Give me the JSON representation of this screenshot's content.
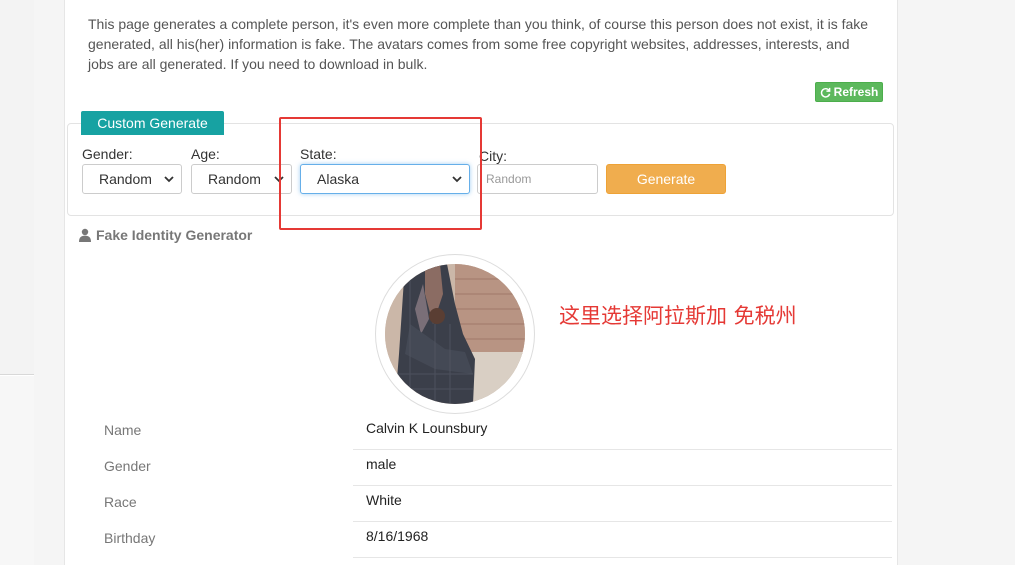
{
  "intro_text": "This page generates a complete person, it's even more complete than you think, of course this person does not exist, it is fake generated, all his(her) information is fake. The avatars comes from some free copyright websites, addresses, interests, and jobs are all generated. If you need to download in bulk.",
  "refresh": {
    "label": "Refresh",
    "icon": "refresh-icon"
  },
  "custom_generate": {
    "tab_label": "Custom Generate"
  },
  "form": {
    "gender": {
      "label": "Gender:",
      "value": "Random"
    },
    "age": {
      "label": "Age:",
      "value": "Random"
    },
    "state": {
      "label": "State:",
      "value": "Alaska"
    },
    "city": {
      "label": "City:",
      "placeholder": "Random"
    },
    "generate_label": "Generate"
  },
  "section": {
    "title": "Fake Identity Generator",
    "icon": "user-icon"
  },
  "annotation": "这里选择阿拉斯加   免税州",
  "colors": {
    "accent_teal": "#17a2a2",
    "refresh_green": "#5cb85c",
    "generate_orange": "#f0ad4e",
    "annotation_red": "#e53935"
  },
  "person": {
    "rows": [
      {
        "key": "Name",
        "value": "Calvin K Lounsbury"
      },
      {
        "key": "Gender",
        "value": "male"
      },
      {
        "key": "Race",
        "value": "White"
      },
      {
        "key": "Birthday",
        "value": "8/16/1968"
      }
    ]
  }
}
